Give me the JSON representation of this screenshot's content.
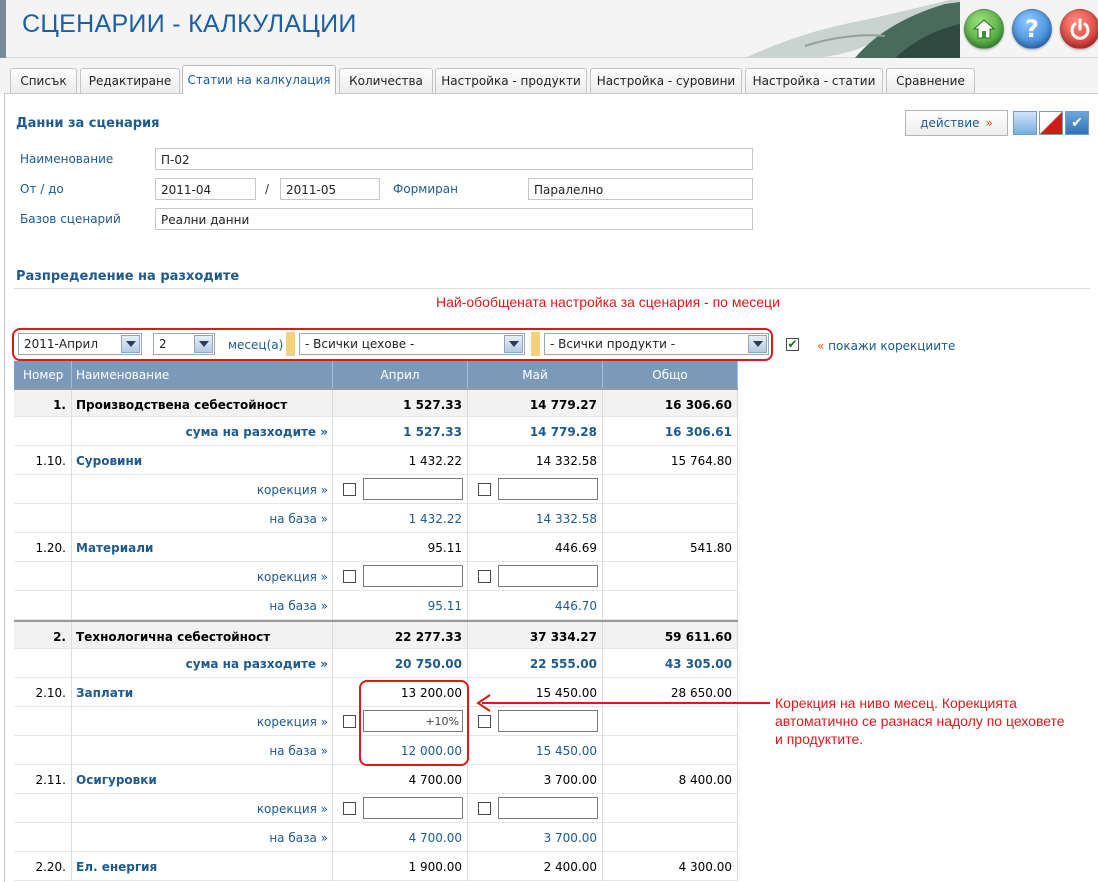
{
  "app": {
    "title": "СЦЕНАРИИ - КАЛКУЛАЦИИ"
  },
  "tabs": [
    {
      "label": "Списък",
      "active": false
    },
    {
      "label": "Редактиране",
      "active": false
    },
    {
      "label": "Статии на калкулация",
      "active": true
    },
    {
      "label": "Количества",
      "active": false
    },
    {
      "label": "Настройка - продукти",
      "active": false
    },
    {
      "label": "Настройка - суровини",
      "active": false
    },
    {
      "label": "Настройка - статии",
      "active": false
    },
    {
      "label": "Сравнение",
      "active": false
    }
  ],
  "scenario": {
    "section_title": "Данни за сценария",
    "action_label": "действие",
    "action_marker": "»",
    "name_label": "Наименование",
    "name_value": "П-02",
    "period_label": "От / до",
    "from_value": "2011-04",
    "period_sep": "/",
    "to_value": "2011-05",
    "formed_label": "Формиран",
    "formed_value": "Паралелно",
    "base_label": "Базов сценарий",
    "base_value": "Реални данни"
  },
  "distribution": {
    "section_title": "Разпределение на разходите",
    "callout_top": "Най-обобщената настройка за сценария - по месеци",
    "month_select": "2011-Април",
    "count_select": "2",
    "months_label": "месец(а)",
    "workshops_select": "- Всички цехове -",
    "products_select": "- Всички продукти -",
    "show_corrections_marker": "«",
    "show_corrections_label": "покажи корекциите",
    "show_corrections_checked": true
  },
  "table": {
    "headers": [
      "Номер",
      "Наименование",
      "Април",
      "Май",
      "Общо"
    ],
    "rows": [
      {
        "type": "group",
        "num": "1.",
        "name": "Производствена себестойност",
        "v1": "1 527.33",
        "v2": "14 779.27",
        "v3": "16 306.60"
      },
      {
        "type": "sum",
        "label": "сума на разходите »",
        "v1": "1 527.33",
        "v2": "14 779.28",
        "v3": "16 306.61"
      },
      {
        "type": "item",
        "num": "1.10.",
        "name": "Суровини",
        "v1": "1 432.22",
        "v2": "14 332.58",
        "v3": "15 764.80"
      },
      {
        "type": "corr",
        "label": "корекция »",
        "in1": "",
        "in2": ""
      },
      {
        "type": "base",
        "label": "на база »",
        "v1": "1 432.22",
        "v2": "14 332.58"
      },
      {
        "type": "item",
        "num": "1.20.",
        "name": "Материали",
        "v1": "95.11",
        "v2": "446.69",
        "v3": "541.80"
      },
      {
        "type": "corr",
        "label": "корекция »",
        "in1": "",
        "in2": ""
      },
      {
        "type": "base",
        "label": "на база »",
        "v1": "95.11",
        "v2": "446.70"
      },
      {
        "type": "group",
        "num": "2.",
        "name": "Технологична себестойност",
        "v1": "22 277.33",
        "v2": "37 334.27",
        "v3": "59 611.60"
      },
      {
        "type": "sum",
        "label": "сума на разходите »",
        "v1": "20 750.00",
        "v2": "22 555.00",
        "v3": "43 305.00"
      },
      {
        "type": "item",
        "num": "2.10.",
        "name": "Заплати",
        "v1": "13 200.00",
        "v2": "15 450.00",
        "v3": "28 650.00"
      },
      {
        "type": "corr",
        "label": "корекция »",
        "in1": "+10%",
        "in2": ""
      },
      {
        "type": "base",
        "label": "на база »",
        "v1": "12 000.00",
        "v2": "15 450.00"
      },
      {
        "type": "item",
        "num": "2.11.",
        "name": "Осигуровки",
        "v1": "4 700.00",
        "v2": "3 700.00",
        "v3": "8 400.00"
      },
      {
        "type": "corr",
        "label": "корекция »",
        "in1": "",
        "in2": ""
      },
      {
        "type": "base",
        "label": "на база »",
        "v1": "4 700.00",
        "v2": "3 700.00"
      },
      {
        "type": "item",
        "num": "2.20.",
        "name": "Ел. енергия",
        "v1": "1 900.00",
        "v2": "2 400.00",
        "v3": "4 300.00"
      }
    ]
  },
  "callout_correction": "Корекция на ниво месец. Корекцията автоматично се разнася надолу по цеховете и продуктите.",
  "colors": {
    "accent": "#1d5a8e",
    "title": "#1a60a6",
    "header_bg": "#7b9aba",
    "highlight": "#e01818"
  },
  "icons": [
    "home-icon",
    "help-icon",
    "power-icon",
    "print-icon",
    "cancel-icon",
    "confirm-icon",
    "dropdown-arrow-icon",
    "checkbox-icon"
  ]
}
